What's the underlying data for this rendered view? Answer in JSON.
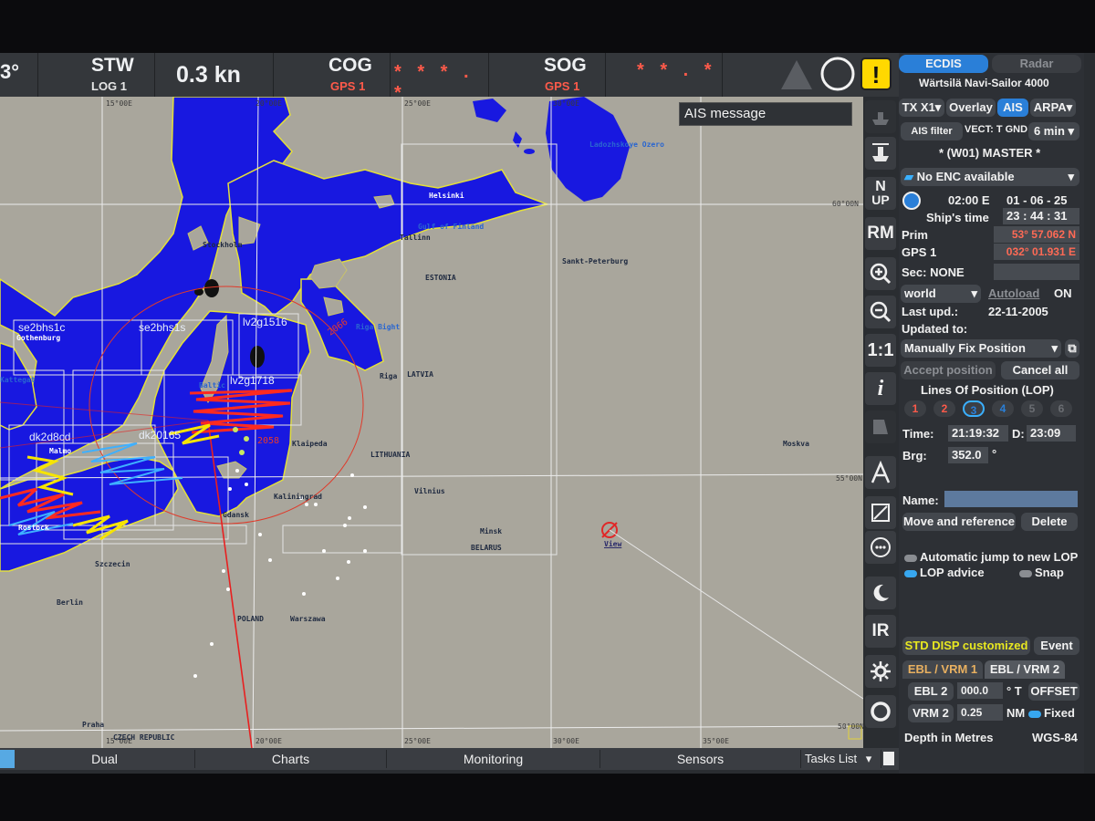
{
  "topbar": {
    "heading_partial": "3°",
    "stw_label": "STW",
    "stw_source": "LOG 1",
    "stw_value": "0.3 kn",
    "cog_label": "COG",
    "cog_source": "GPS 1",
    "cog_value": "* * * . *",
    "sog_label": "SOG",
    "sog_source": "GPS 1",
    "sog_value": "* * . *"
  },
  "chart": {
    "ais_message": "AIS message",
    "lon_labels": [
      "15°00E",
      "20°00E",
      "25°00E",
      "30°00E",
      "35°00E"
    ],
    "lat_labels": [
      "60°00N",
      "55°00N",
      "50°00N"
    ],
    "cells": [
      "se2bhs1c",
      "se2bhs1s",
      "lv2g1516",
      "lv2g1718",
      "dk20165",
      "dk2d8cd"
    ],
    "places": {
      "helsinki": "Helsinki",
      "stpete": "Sankt-Peterburg",
      "ladoga": "Ladozhskoye Ozero",
      "gulf": "Gulf of Finland",
      "tallinn": "Tallinn",
      "stockholm": "Stockholm",
      "estonia": "ESTONIA",
      "gothenburg": "Gothenburg",
      "riga_bight": "Riga Bight",
      "riga": "Riga",
      "latvia": "LATVIA",
      "klaipeda": "Klaipeda",
      "lithuania": "LITHUANIA",
      "vilnius": "Vilnius",
      "moskva": "Moskva",
      "kaliningrad": "Kaliningrad",
      "gdansk": "Gdansk",
      "minsk": "Minsk",
      "belarus": "BELARUS",
      "szczecin": "Szczecin",
      "berlin": "Berlin",
      "poland": "POLAND",
      "warszawa": "Warszawa",
      "praha": "Praha",
      "czech": "CZECH REPUBLIC",
      "rostock": "Rostock",
      "malmo": "Malmo",
      "kattegat": "Kattegat",
      "baltic": "Baltic"
    },
    "range_labels": [
      "2066",
      "2058"
    ],
    "view_label": "View"
  },
  "bottombar": {
    "tabs": [
      "Dual",
      "Charts",
      "Monitoring",
      "Sensors"
    ],
    "tasks_list": "Tasks List"
  },
  "panel": {
    "mode_ecdis": "ECDIS",
    "mode_radar": "Radar",
    "product": "Wärtsilä Navi-Sailor 4000",
    "tx_label": "TX X1",
    "overlay_label": "Overlay",
    "ais_label": "AIS",
    "arpa_label": "ARPA",
    "ais_filter": "AIS filter",
    "vect_label": "VECT: T GND",
    "vect_time": "6 min",
    "master": "* (W01) MASTER *",
    "enc_status": "No ENC available",
    "time_zone": "02:00 E",
    "date": "01 - 06 - 25",
    "ships_time_label": "Ship's time",
    "ships_time": "23 : 44 : 31",
    "prim_label": "Prim",
    "lat": "53° 57.062 N",
    "gps_label": "GPS 1",
    "lon": "032° 01.931 E",
    "sec_label": "Sec: NONE",
    "chart_set": "world",
    "autoload": "Autoload",
    "autoload_state": "ON",
    "last_upd_label": "Last upd.:",
    "last_upd": "22-11-2005",
    "updated_to_label": "Updated to:",
    "fix_mode": "Manually Fix Position",
    "accept_position": "Accept position",
    "cancel_all": "Cancel all",
    "lop_title": "Lines Of Position (LOP)",
    "lop_numbers": [
      "1",
      "2",
      "3",
      "4",
      "5",
      "6"
    ],
    "time_label": "Time:",
    "time_value": "21:19:32",
    "d_label": "D:",
    "d_value": "23:09",
    "brg_label": "Brg:",
    "brg_value": "352.0",
    "brg_unit": "°",
    "name_label": "Name:",
    "move_ref": "Move and reference",
    "delete": "Delete",
    "auto_jump": "Automatic jump to new LOP",
    "lop_advice": "LOP advice",
    "snap": "Snap",
    "std_disp": "STD DISP customized",
    "event": "Event",
    "ebl_vrm1": "EBL / VRM 1",
    "ebl_vrm2": "EBL / VRM 2",
    "ebl2_label": "EBL 2",
    "ebl2_value": "000.0",
    "ebl2_unit": "° T",
    "offset": "OFFSET",
    "vrm2_label": "VRM 2",
    "vrm2_value": "0.25",
    "vrm2_unit": "NM",
    "fixed": "Fixed",
    "depth_units": "Depth in Metres",
    "datum": "WGS-84"
  },
  "iconbar": {
    "north_up_top": "N",
    "north_up_bottom": "UP",
    "rm": "RM",
    "scale_1to1": "1:1",
    "info": "i",
    "ir": "IR"
  },
  "colors": {
    "sea": "#1818e0",
    "land": "#a9a69c",
    "accent": "#2a7fd8",
    "alert": "#ffd800",
    "position_red": "#ff5a4a"
  }
}
